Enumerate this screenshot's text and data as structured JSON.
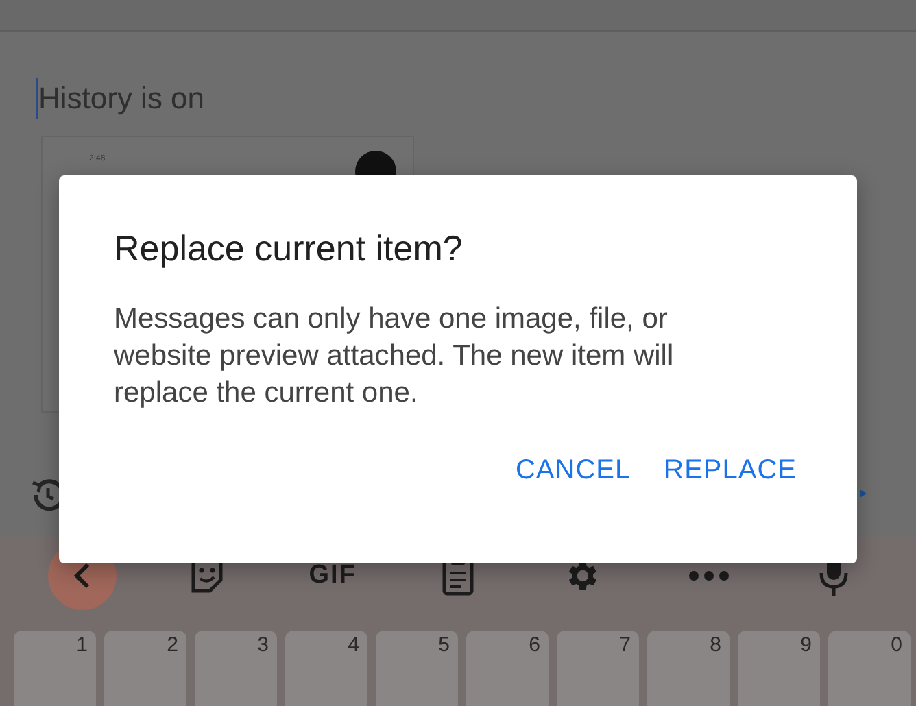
{
  "compose": {
    "placeholder": "History is on",
    "attachment": {
      "time": "2:48"
    }
  },
  "dialog": {
    "title": "Replace current item?",
    "message": "Messages can only have one image, file, or website preview attached. The new item will replace the current one.",
    "buttons": [
      "CANCEL",
      "REPLACE"
    ]
  },
  "keyboard": {
    "toolbar": [
      {
        "kind": "back"
      },
      {
        "kind": "sticker"
      },
      {
        "kind": "gif",
        "label": "GIF"
      },
      {
        "kind": "clipboard"
      },
      {
        "kind": "settings"
      },
      {
        "kind": "more"
      },
      {
        "kind": "mic"
      }
    ],
    "number_hints": [
      "1",
      "2",
      "3",
      "4",
      "5",
      "6",
      "7",
      "8",
      "9",
      "0"
    ]
  }
}
